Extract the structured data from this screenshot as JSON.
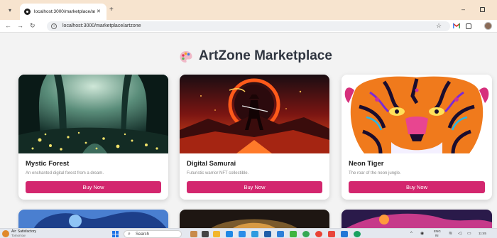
{
  "browser": {
    "tab_title": "localhost:3000/marketplace/art",
    "tab_close": "✕",
    "new_tab": "+",
    "url": "localhost:3000/marketplace/artzone",
    "icons": [
      "chevron-down-icon",
      "close-icon",
      "plus-icon",
      "back-icon",
      "forward-icon",
      "reload-icon",
      "info-icon",
      "star-icon",
      "gmail-icon",
      "extensions-icon",
      "profile-icon",
      "minimize-icon",
      "maximize-icon"
    ]
  },
  "page": {
    "title": "ArtZone Marketplace",
    "accent_color": "#d3266e"
  },
  "cards": [
    {
      "title": "Mystic Forest",
      "description": "An enchanted digital forest from a dream.",
      "button": "Buy Now"
    },
    {
      "title": "Digital Samurai",
      "description": "Futuristic warrior NFT collectible.",
      "button": "Buy Now"
    },
    {
      "title": "Neon Tiger",
      "description": "The roar of the neon jungle.",
      "button": "Buy Now"
    }
  ],
  "taskbar": {
    "weather_label": "Air: Satisfactory",
    "weather_sub": "Tomorrow",
    "search_placeholder": "Search",
    "language": "ENG",
    "language_sub": "IN",
    "time": "11:45"
  }
}
